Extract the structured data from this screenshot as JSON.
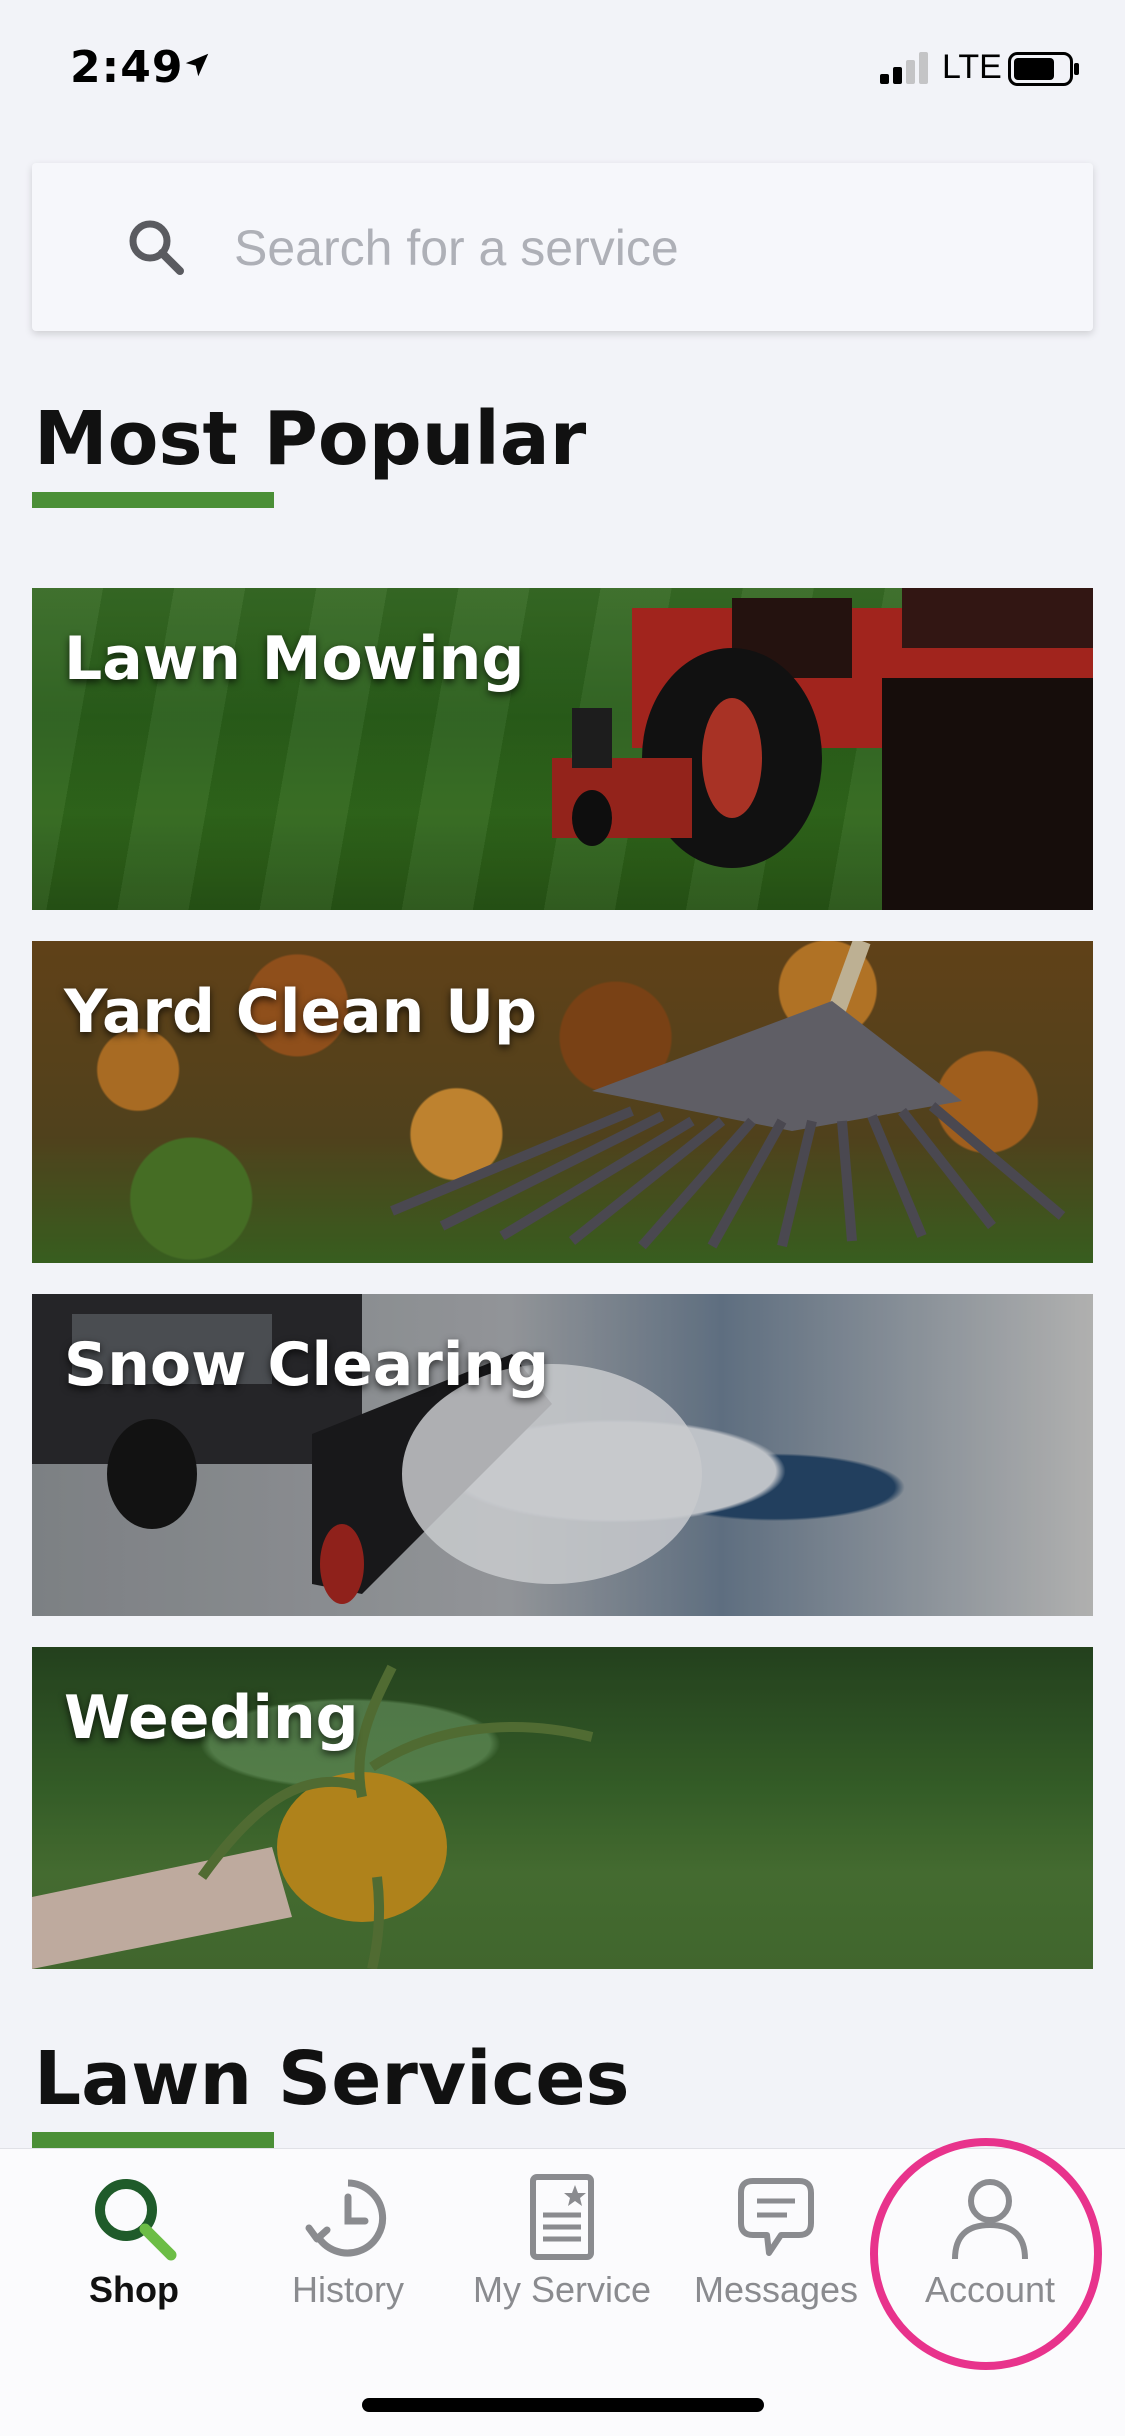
{
  "status_bar": {
    "time": "2:49",
    "network": "LTE",
    "location_icon": "location-arrow-icon",
    "signal_icon": "cellular-signal-icon",
    "battery_icon": "battery-icon"
  },
  "search": {
    "placeholder": "Search for a service",
    "icon": "search-icon"
  },
  "sections": {
    "most_popular": "Most Popular",
    "lawn_services": "Lawn Services"
  },
  "popular_services": [
    {
      "label": "Lawn Mowing"
    },
    {
      "label": "Yard Clean Up"
    },
    {
      "label": "Snow Clearing"
    },
    {
      "label": "Weeding"
    }
  ],
  "tab_bar": {
    "tabs": [
      {
        "label": "Shop",
        "icon": "search-icon",
        "active": true
      },
      {
        "label": "History",
        "icon": "clock-history-icon",
        "active": false
      },
      {
        "label": "My Service",
        "icon": "document-star-icon",
        "active": false
      },
      {
        "label": "Messages",
        "icon": "chat-bubble-icon",
        "active": false
      },
      {
        "label": "Account",
        "icon": "person-icon",
        "active": false
      }
    ]
  },
  "colors": {
    "accent_green": "#4b8f37",
    "highlight_pink": "#e8338c",
    "background": "#f2f3f8"
  }
}
